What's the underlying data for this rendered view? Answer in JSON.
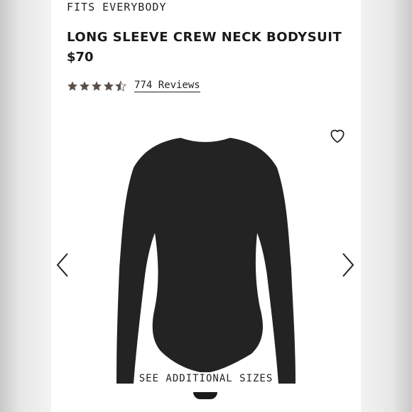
{
  "product": {
    "collection": "FITS EVERYBODY",
    "name": "LONG SLEEVE CREW NECK BODYSUIT",
    "price": "$70",
    "rating": {
      "stars": 4.5,
      "max_stars": 5,
      "reviews_label": "774 Reviews",
      "star_color": "#5b5049"
    },
    "see_sizes_label": "SEE ADDITIONAL SIZES",
    "garment_color": "#232323"
  },
  "icons": {
    "wishlist": "heart-outline-icon",
    "previous": "chevron-left-icon",
    "next": "chevron-right-icon"
  }
}
